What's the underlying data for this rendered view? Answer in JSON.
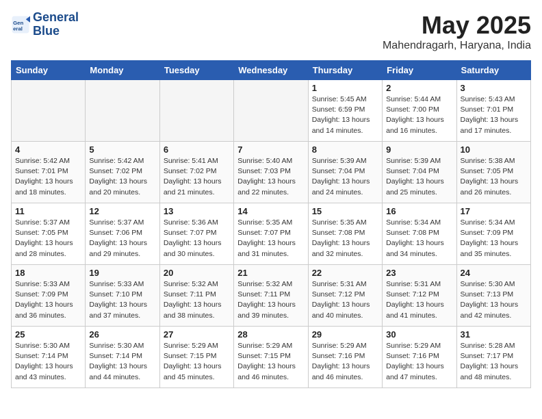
{
  "logo": {
    "line1": "General",
    "line2": "Blue"
  },
  "title": "May 2025",
  "location": "Mahendragarh, Haryana, India",
  "weekdays": [
    "Sunday",
    "Monday",
    "Tuesday",
    "Wednesday",
    "Thursday",
    "Friday",
    "Saturday"
  ],
  "weeks": [
    [
      {
        "day": "",
        "info": ""
      },
      {
        "day": "",
        "info": ""
      },
      {
        "day": "",
        "info": ""
      },
      {
        "day": "",
        "info": ""
      },
      {
        "day": "1",
        "info": "Sunrise: 5:45 AM\nSunset: 6:59 PM\nDaylight: 13 hours\nand 14 minutes."
      },
      {
        "day": "2",
        "info": "Sunrise: 5:44 AM\nSunset: 7:00 PM\nDaylight: 13 hours\nand 16 minutes."
      },
      {
        "day": "3",
        "info": "Sunrise: 5:43 AM\nSunset: 7:01 PM\nDaylight: 13 hours\nand 17 minutes."
      }
    ],
    [
      {
        "day": "4",
        "info": "Sunrise: 5:42 AM\nSunset: 7:01 PM\nDaylight: 13 hours\nand 18 minutes."
      },
      {
        "day": "5",
        "info": "Sunrise: 5:42 AM\nSunset: 7:02 PM\nDaylight: 13 hours\nand 20 minutes."
      },
      {
        "day": "6",
        "info": "Sunrise: 5:41 AM\nSunset: 7:02 PM\nDaylight: 13 hours\nand 21 minutes."
      },
      {
        "day": "7",
        "info": "Sunrise: 5:40 AM\nSunset: 7:03 PM\nDaylight: 13 hours\nand 22 minutes."
      },
      {
        "day": "8",
        "info": "Sunrise: 5:39 AM\nSunset: 7:04 PM\nDaylight: 13 hours\nand 24 minutes."
      },
      {
        "day": "9",
        "info": "Sunrise: 5:39 AM\nSunset: 7:04 PM\nDaylight: 13 hours\nand 25 minutes."
      },
      {
        "day": "10",
        "info": "Sunrise: 5:38 AM\nSunset: 7:05 PM\nDaylight: 13 hours\nand 26 minutes."
      }
    ],
    [
      {
        "day": "11",
        "info": "Sunrise: 5:37 AM\nSunset: 7:05 PM\nDaylight: 13 hours\nand 28 minutes."
      },
      {
        "day": "12",
        "info": "Sunrise: 5:37 AM\nSunset: 7:06 PM\nDaylight: 13 hours\nand 29 minutes."
      },
      {
        "day": "13",
        "info": "Sunrise: 5:36 AM\nSunset: 7:07 PM\nDaylight: 13 hours\nand 30 minutes."
      },
      {
        "day": "14",
        "info": "Sunrise: 5:35 AM\nSunset: 7:07 PM\nDaylight: 13 hours\nand 31 minutes."
      },
      {
        "day": "15",
        "info": "Sunrise: 5:35 AM\nSunset: 7:08 PM\nDaylight: 13 hours\nand 32 minutes."
      },
      {
        "day": "16",
        "info": "Sunrise: 5:34 AM\nSunset: 7:08 PM\nDaylight: 13 hours\nand 34 minutes."
      },
      {
        "day": "17",
        "info": "Sunrise: 5:34 AM\nSunset: 7:09 PM\nDaylight: 13 hours\nand 35 minutes."
      }
    ],
    [
      {
        "day": "18",
        "info": "Sunrise: 5:33 AM\nSunset: 7:09 PM\nDaylight: 13 hours\nand 36 minutes."
      },
      {
        "day": "19",
        "info": "Sunrise: 5:33 AM\nSunset: 7:10 PM\nDaylight: 13 hours\nand 37 minutes."
      },
      {
        "day": "20",
        "info": "Sunrise: 5:32 AM\nSunset: 7:11 PM\nDaylight: 13 hours\nand 38 minutes."
      },
      {
        "day": "21",
        "info": "Sunrise: 5:32 AM\nSunset: 7:11 PM\nDaylight: 13 hours\nand 39 minutes."
      },
      {
        "day": "22",
        "info": "Sunrise: 5:31 AM\nSunset: 7:12 PM\nDaylight: 13 hours\nand 40 minutes."
      },
      {
        "day": "23",
        "info": "Sunrise: 5:31 AM\nSunset: 7:12 PM\nDaylight: 13 hours\nand 41 minutes."
      },
      {
        "day": "24",
        "info": "Sunrise: 5:30 AM\nSunset: 7:13 PM\nDaylight: 13 hours\nand 42 minutes."
      }
    ],
    [
      {
        "day": "25",
        "info": "Sunrise: 5:30 AM\nSunset: 7:14 PM\nDaylight: 13 hours\nand 43 minutes."
      },
      {
        "day": "26",
        "info": "Sunrise: 5:30 AM\nSunset: 7:14 PM\nDaylight: 13 hours\nand 44 minutes."
      },
      {
        "day": "27",
        "info": "Sunrise: 5:29 AM\nSunset: 7:15 PM\nDaylight: 13 hours\nand 45 minutes."
      },
      {
        "day": "28",
        "info": "Sunrise: 5:29 AM\nSunset: 7:15 PM\nDaylight: 13 hours\nand 46 minutes."
      },
      {
        "day": "29",
        "info": "Sunrise: 5:29 AM\nSunset: 7:16 PM\nDaylight: 13 hours\nand 46 minutes."
      },
      {
        "day": "30",
        "info": "Sunrise: 5:29 AM\nSunset: 7:16 PM\nDaylight: 13 hours\nand 47 minutes."
      },
      {
        "day": "31",
        "info": "Sunrise: 5:28 AM\nSunset: 7:17 PM\nDaylight: 13 hours\nand 48 minutes."
      }
    ]
  ]
}
